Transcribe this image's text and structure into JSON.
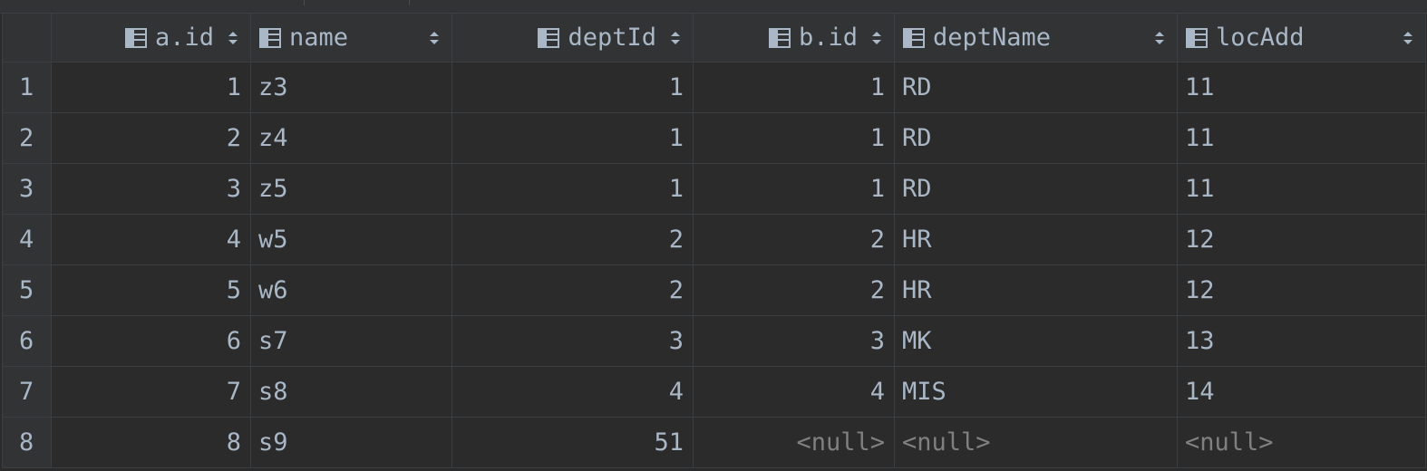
{
  "columns": [
    {
      "label": "a.id",
      "align": "right"
    },
    {
      "label": "name",
      "align": "left"
    },
    {
      "label": "deptId",
      "align": "right"
    },
    {
      "label": "b.id",
      "align": "right"
    },
    {
      "label": "deptName",
      "align": "left"
    },
    {
      "label": "locAdd",
      "align": "left"
    }
  ],
  "rows": [
    {
      "num": "1",
      "cells": [
        "1",
        "z3",
        "1",
        "1",
        "RD",
        "11"
      ]
    },
    {
      "num": "2",
      "cells": [
        "2",
        "z4",
        "1",
        "1",
        "RD",
        "11"
      ]
    },
    {
      "num": "3",
      "cells": [
        "3",
        "z5",
        "1",
        "1",
        "RD",
        "11"
      ]
    },
    {
      "num": "4",
      "cells": [
        "4",
        "w5",
        "2",
        "2",
        "HR",
        "12"
      ]
    },
    {
      "num": "5",
      "cells": [
        "5",
        "w6",
        "2",
        "2",
        "HR",
        "12"
      ]
    },
    {
      "num": "6",
      "cells": [
        "6",
        "s7",
        "3",
        "3",
        "MK",
        "13"
      ]
    },
    {
      "num": "7",
      "cells": [
        "7",
        "s8",
        "4",
        "4",
        "MIS",
        "14"
      ]
    },
    {
      "num": "8",
      "cells": [
        "8",
        "s9",
        "51",
        "<null>",
        "<null>",
        "<null>"
      ]
    }
  ],
  "null_text": "<null>",
  "icons": {
    "column": "column-table-icon",
    "sort": "sort-toggle-icon"
  },
  "colors": {
    "background": "#2b2b2b",
    "header_bg": "#313335",
    "grid_line": "#3c3f41",
    "text": "#a9b7c6",
    "null_text": "#808080"
  }
}
